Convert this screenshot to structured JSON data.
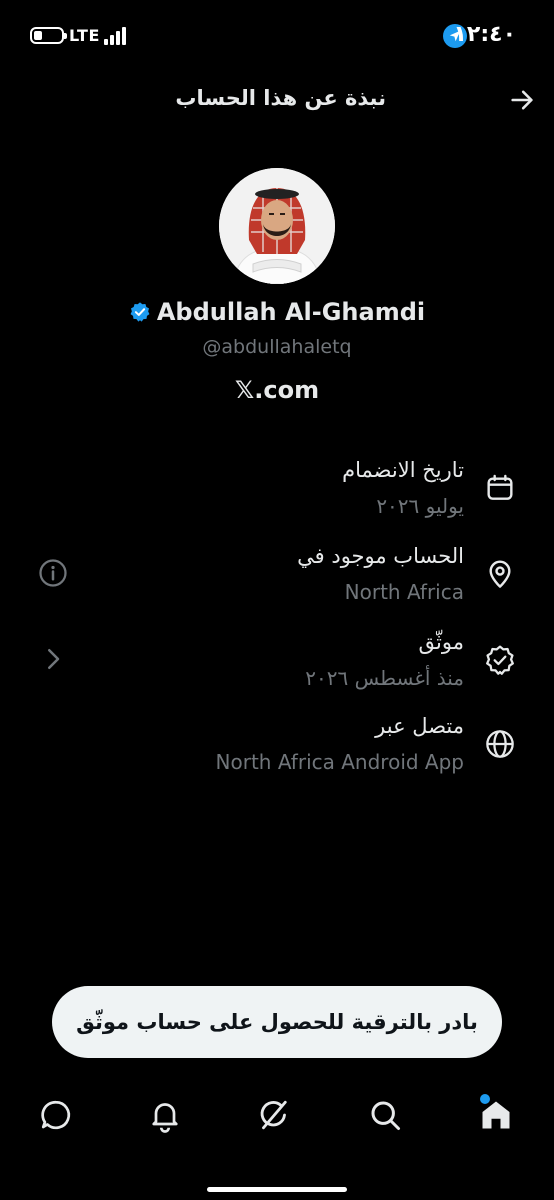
{
  "status_bar": {
    "network": "LTE",
    "time": "١٢:٤٠",
    "battery_level": 0.25,
    "location_icon": "location-arrow-icon"
  },
  "header": {
    "title": "نبذة عن هذا الحساب",
    "back_icon": "arrow-right-icon"
  },
  "profile": {
    "name": "Abdullah Al-Ghamdi",
    "handle": "@abdullahaletq",
    "site": "𝕏.com",
    "verified_color": "#1d9bf0"
  },
  "info_rows": [
    {
      "title": "تاريخ الانضمام",
      "value": "يوليو ٢٠٢٦",
      "icon": "calendar-icon"
    },
    {
      "title": "الحساب موجود في",
      "value": "North Africa",
      "icon": "location-pin-icon",
      "left_icon": "info-icon"
    },
    {
      "title": "موثّق",
      "value": "منذ أغسطس ٢٠٢٦",
      "icon": "verified-badge-icon",
      "left_icon": "chevron-right-icon"
    },
    {
      "title": "متصل عبر",
      "value": "North Africa Android App",
      "icon": "globe-icon"
    }
  ],
  "upgrade": {
    "label": "بادر بالترقية للحصول على حساب موثّق"
  },
  "nav": {
    "items": [
      "messages-icon",
      "notifications-icon",
      "grok-icon",
      "search-icon",
      "home-icon"
    ],
    "accent": "#1d9bf0"
  }
}
